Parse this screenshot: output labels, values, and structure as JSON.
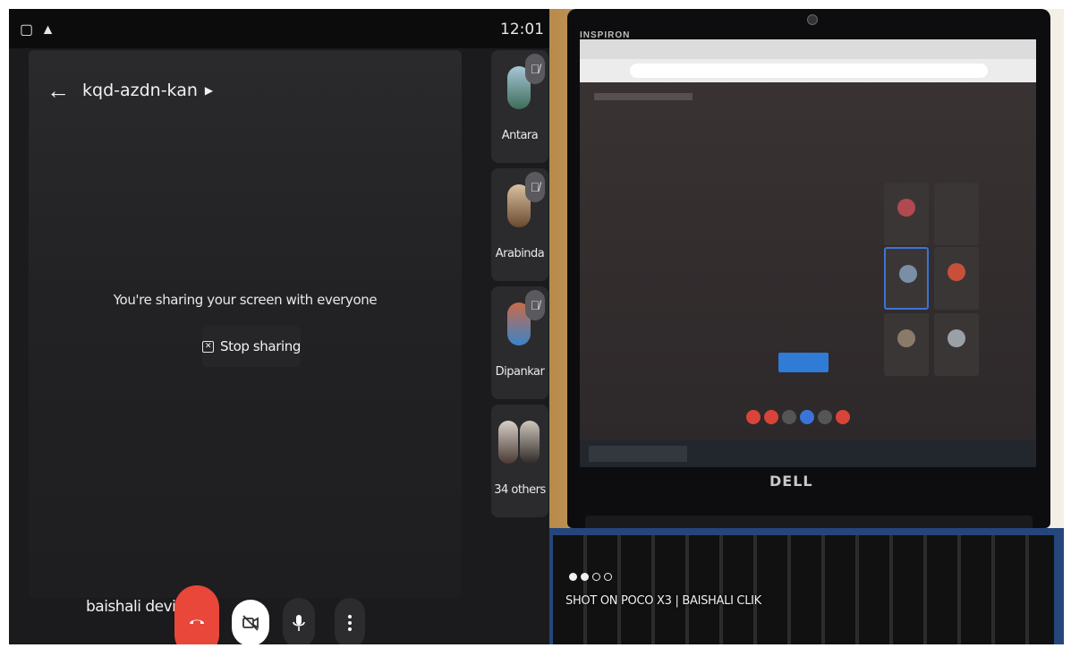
{
  "status_bar": {
    "left_icons": "▢ ▲",
    "time": "12:01"
  },
  "meeting": {
    "code": "kqd-azdn-kan",
    "share_message": "You're sharing your screen with everyone",
    "stop_sharing_label": "Stop sharing",
    "self_name": "baishali devi"
  },
  "participants": [
    {
      "name": "Antara",
      "muted": true
    },
    {
      "name": "Arabinda",
      "muted": true
    },
    {
      "name": "Dipankar",
      "muted": true
    },
    {
      "name": "34 others",
      "muted": false
    }
  ],
  "controls": {
    "end_call_color": "#e8473a",
    "camera": "camera-off",
    "mic": "mic-on",
    "more": "more-options"
  },
  "photo": {
    "bezel_brand": "INSPIRON",
    "laptop_logo": "DELL",
    "watermark": "SHOT ON POCO X3 | BAISHALI CLIK"
  }
}
